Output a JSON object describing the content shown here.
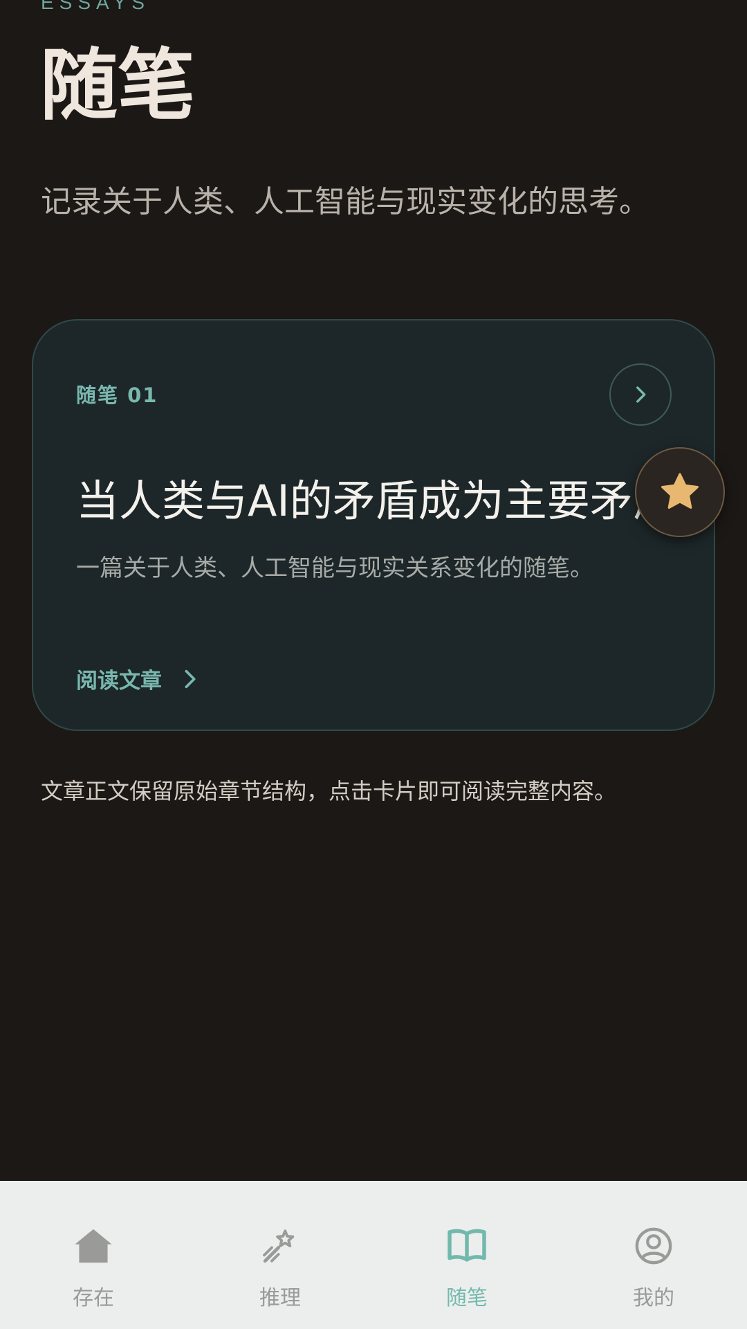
{
  "header": {
    "eyebrow": "ESSAYS",
    "title": "随笔",
    "subtitle": "记录关于人类、人工智能与现实变化的思考。"
  },
  "card": {
    "index": "随笔 01",
    "title": "当人类与AI的矛盾成为主要矛盾",
    "description": "一篇关于人类、人工智能与现实关系变化的随笔。",
    "read_label": "阅读文章"
  },
  "footer_note": "文章正文保留原始章节结构，点击卡片即可阅读完整内容。",
  "fab": {
    "icon": "star-icon"
  },
  "tabs": [
    {
      "label": "存在",
      "icon": "home-icon",
      "active": false
    },
    {
      "label": "推理",
      "icon": "magic-wand-icon",
      "active": false
    },
    {
      "label": "随笔",
      "icon": "book-icon",
      "active": true
    },
    {
      "label": "我的",
      "icon": "user-icon",
      "active": false
    }
  ],
  "colors": {
    "background": "#1c1815",
    "accent": "#72b9ad",
    "card_bg": "#1d2729",
    "star": "#e9b870",
    "tab_bar_bg": "#eceeed"
  }
}
